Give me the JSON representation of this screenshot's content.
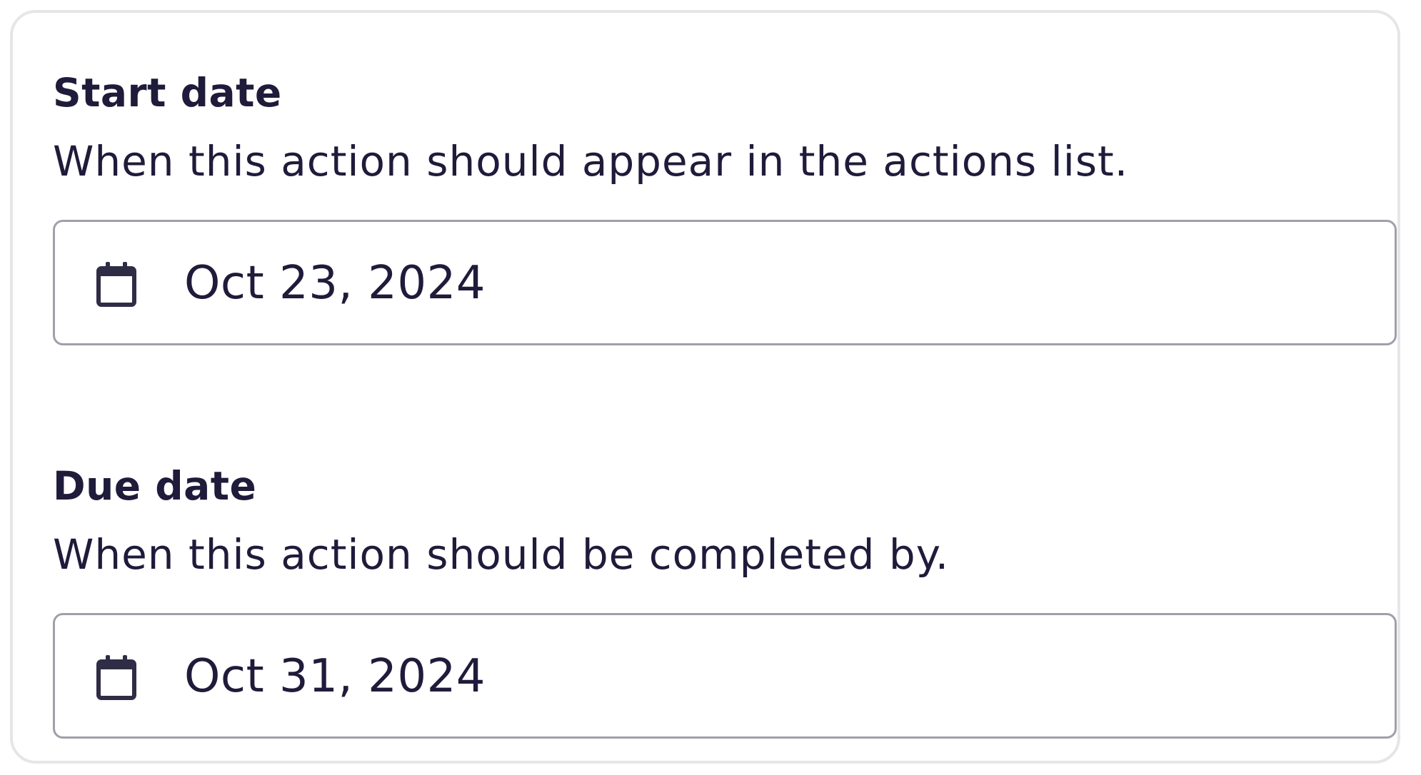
{
  "start_date": {
    "label": "Start date",
    "description": "When this action should appear in the actions list.",
    "value": "Oct 23, 2024",
    "icon": "calendar-icon"
  },
  "due_date": {
    "label": "Due date",
    "description": "When this action should be completed by.",
    "value": "Oct 31, 2024",
    "icon": "calendar-icon"
  },
  "colors": {
    "text": "#1f1b3a",
    "input_border": "#a09fab",
    "card_border": "#e6e6e9"
  }
}
